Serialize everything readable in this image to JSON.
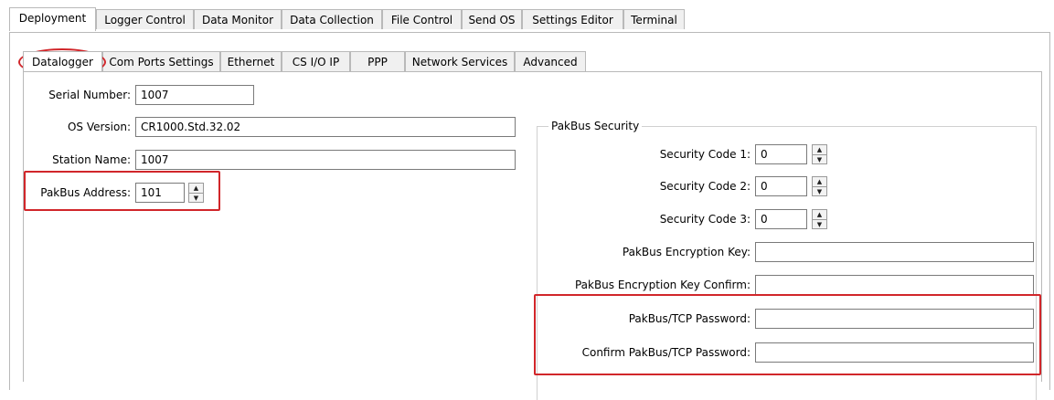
{
  "top_tabs": [
    {
      "label": "Deployment"
    },
    {
      "label": "Logger Control"
    },
    {
      "label": "Data Monitor"
    },
    {
      "label": "Data Collection"
    },
    {
      "label": "File Control"
    },
    {
      "label": "Send OS"
    },
    {
      "label": "Settings Editor"
    },
    {
      "label": "Terminal"
    }
  ],
  "sub_tabs": [
    {
      "label": "Datalogger"
    },
    {
      "label": "Com Ports Settings"
    },
    {
      "label": "Ethernet"
    },
    {
      "label": "CS I/O IP"
    },
    {
      "label": "PPP"
    },
    {
      "label": "Network Services"
    },
    {
      "label": "Advanced"
    }
  ],
  "datalogger": {
    "serial_number": {
      "label": "Serial Number:",
      "value": "1007"
    },
    "os_version": {
      "label": "OS Version:",
      "value": "CR1000.Std.32.02"
    },
    "station_name": {
      "label": "Station Name:",
      "value": "1007"
    },
    "pakbus_address": {
      "label": "PakBus Address:",
      "value": "101"
    }
  },
  "security": {
    "title": "PakBus Security",
    "code1": {
      "label": "Security Code 1:",
      "value": "0"
    },
    "code2": {
      "label": "Security Code 2:",
      "value": "0"
    },
    "code3": {
      "label": "Security Code 3:",
      "value": "0"
    },
    "enc_key": {
      "label": "PakBus Encryption Key:",
      "value": ""
    },
    "enc_key_confirm": {
      "label": "PakBus Encryption Key Confirm:",
      "value": ""
    },
    "tcp_password": {
      "label": "PakBus/TCP Password:",
      "value": ""
    },
    "tcp_password_confirm": {
      "label": "Confirm PakBus/TCP Password:",
      "value": ""
    }
  },
  "highlight_color": "#d1262a",
  "icons": {
    "spin_up": "▲",
    "spin_down": "▼"
  }
}
